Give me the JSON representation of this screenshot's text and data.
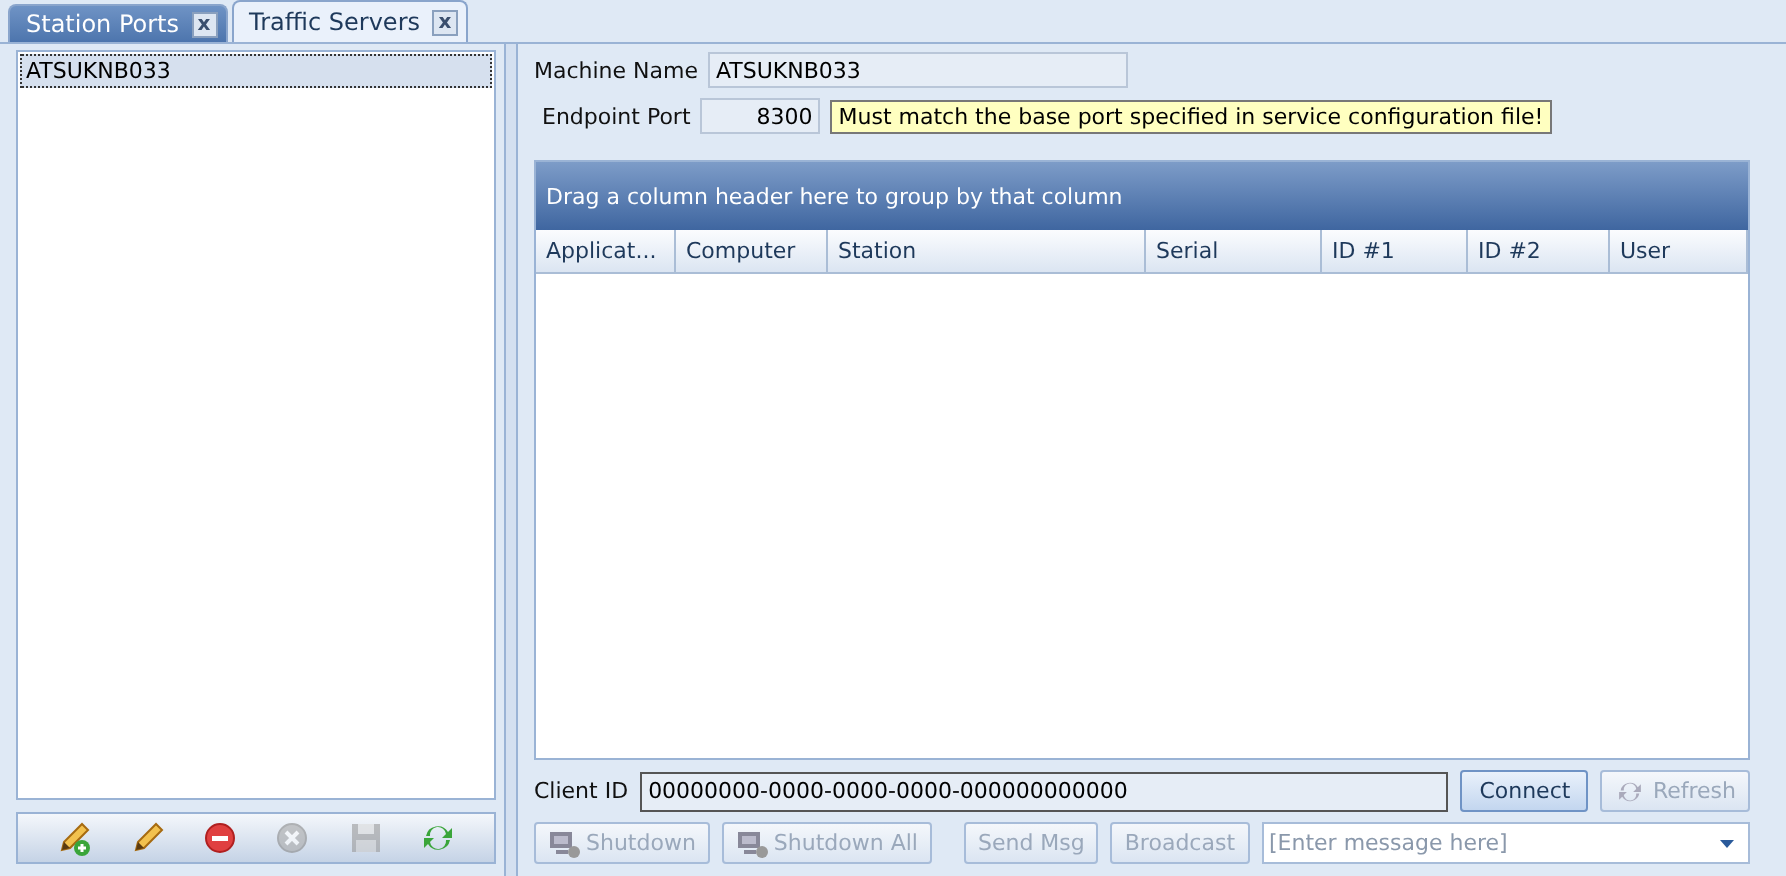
{
  "tabs": [
    {
      "label": "Station Ports",
      "selected": false,
      "close": "x"
    },
    {
      "label": "Traffic Servers",
      "selected": true,
      "close": "x"
    }
  ],
  "servers": [
    {
      "name": "ATSUKNB033",
      "selected": true
    }
  ],
  "toolbar": [
    {
      "kind": "add",
      "disabled": false
    },
    {
      "kind": "edit",
      "disabled": false
    },
    {
      "kind": "delete",
      "disabled": false
    },
    {
      "kind": "cancel",
      "disabled": true
    },
    {
      "kind": "save",
      "disabled": true
    },
    {
      "kind": "refresh",
      "disabled": false
    }
  ],
  "machine_name": {
    "label": "Machine Name",
    "value": "ATSUKNB033"
  },
  "endpoint_port": {
    "label": "Endpoint Port",
    "value": "8300",
    "hint": "Must match the base port specified in service configuration file!"
  },
  "grid": {
    "group_panel": "Drag a column header here to group by that column",
    "columns": [
      "Applicat...",
      "Computer",
      "Station",
      "Serial",
      "ID #1",
      "ID #2",
      "User"
    ]
  },
  "client_id": {
    "label": "Client ID",
    "value": "00000000-0000-0000-0000-000000000000"
  },
  "connect_buttons": [
    {
      "label": "Connect",
      "disabled": false,
      "icon": false
    },
    {
      "label": "Refresh",
      "disabled": true,
      "icon": true
    }
  ],
  "action_buttons": [
    {
      "label": "Shutdown",
      "disabled": true,
      "icon": true
    },
    {
      "label": "Shutdown All",
      "disabled": true,
      "icon": true
    },
    {
      "label": "Send Msg",
      "disabled": true,
      "icon": false
    },
    {
      "label": "Broadcast",
      "disabled": true,
      "icon": false
    }
  ],
  "message": {
    "placeholder": "[Enter message here]"
  }
}
